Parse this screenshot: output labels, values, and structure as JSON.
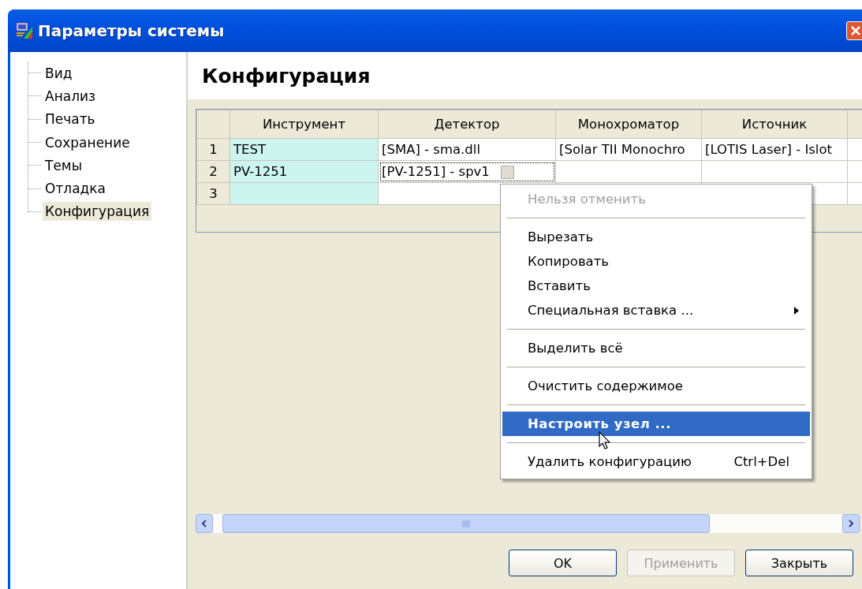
{
  "window": {
    "title": "Параметры системы"
  },
  "sidebar": {
    "items": [
      {
        "label": "Вид",
        "selected": false
      },
      {
        "label": "Анализ",
        "selected": false
      },
      {
        "label": "Печать",
        "selected": false
      },
      {
        "label": "Сохранение",
        "selected": false
      },
      {
        "label": "Темы",
        "selected": false
      },
      {
        "label": "Отладка",
        "selected": false
      },
      {
        "label": "Конфигурация",
        "selected": true
      }
    ]
  },
  "panel": {
    "heading": "Конфигурация"
  },
  "table": {
    "columns": [
      "Инструмент",
      "Детектор",
      "Монохроматор",
      "Источник"
    ],
    "rows": [
      {
        "number": "1",
        "cells": [
          {
            "text": "TEST",
            "focused": false
          },
          {
            "text": "[SMA] - sma.dll",
            "focused": false
          },
          {
            "text": "[Solar TII Monochro",
            "focused": false
          },
          {
            "text": "[LOTIS Laser] - Islot",
            "focused": false
          }
        ]
      },
      {
        "number": "2",
        "cells": [
          {
            "text": "PV-1251",
            "focused": false
          },
          {
            "text": "[PV-1251] - spv1",
            "focused": true
          },
          {
            "focused": false
          },
          {
            "focused": false
          }
        ]
      },
      {
        "number": "3",
        "cells": [
          {
            "focused": false
          },
          {
            "focused": false
          }
        ]
      }
    ]
  },
  "context_menu": {
    "items": [
      {
        "kind": "item",
        "label": "Нельзя отменить",
        "disabled": true,
        "selected": false
      },
      {
        "kind": "separator"
      },
      {
        "kind": "item",
        "label": "Вырезать",
        "disabled": false,
        "selected": false
      },
      {
        "kind": "item",
        "label": "Копировать",
        "disabled": false,
        "selected": false
      },
      {
        "kind": "item",
        "label": "Вставить",
        "disabled": false,
        "selected": false
      },
      {
        "kind": "item",
        "label": "Специальная вставка ...",
        "disabled": false,
        "selected": false,
        "submenu": true
      },
      {
        "kind": "separator"
      },
      {
        "kind": "item",
        "label": "Выделить всё",
        "disabled": false,
        "selected": false
      },
      {
        "kind": "separator"
      },
      {
        "kind": "item",
        "label": "Очистить содержимое",
        "disabled": false,
        "selected": false
      },
      {
        "kind": "separator"
      },
      {
        "kind": "item",
        "label": "Настроить узел ...",
        "disabled": false,
        "selected": true
      },
      {
        "kind": "separator"
      },
      {
        "kind": "item",
        "label": "Удалить конфигурацию",
        "disabled": false,
        "selected": false,
        "shortcut": "Ctrl+Del"
      }
    ]
  },
  "buttons": [
    {
      "label": "OK",
      "disabled": false
    },
    {
      "label": "Применить",
      "disabled": true
    },
    {
      "label": "Закрыть",
      "disabled": false
    }
  ]
}
